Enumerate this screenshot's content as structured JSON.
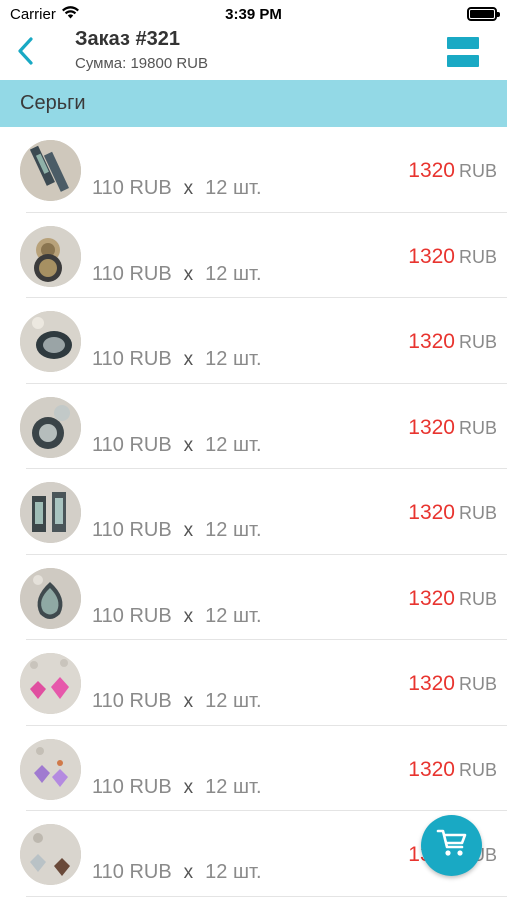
{
  "status_bar": {
    "carrier": "Carrier",
    "time": "3:39 PM",
    "wifi_icon": "wifi-icon",
    "battery_icon": "battery-icon"
  },
  "header": {
    "title": "Заказ #321",
    "sum": "Сумма: 19800 RUB",
    "back_icon": "chevron-left-icon",
    "menu_icon": "menu-icon",
    "accent_color": "#19a9c4"
  },
  "section": {
    "title": "Серьги",
    "color": "#93d9e6"
  },
  "items": [
    {
      "unit_price": "110 RUB",
      "times": "x",
      "qty": "12 шт.",
      "total_amount": "1320",
      "total_currency": "RUB"
    },
    {
      "unit_price": "110 RUB",
      "times": "x",
      "qty": "12 шт.",
      "total_amount": "1320",
      "total_currency": "RUB"
    },
    {
      "unit_price": "110 RUB",
      "times": "x",
      "qty": "12 шт.",
      "total_amount": "1320",
      "total_currency": "RUB"
    },
    {
      "unit_price": "110 RUB",
      "times": "x",
      "qty": "12 шт.",
      "total_amount": "1320",
      "total_currency": "RUB"
    },
    {
      "unit_price": "110 RUB",
      "times": "x",
      "qty": "12 шт.",
      "total_amount": "1320",
      "total_currency": "RUB"
    },
    {
      "unit_price": "110 RUB",
      "times": "x",
      "qty": "12 шт.",
      "total_amount": "1320",
      "total_currency": "RUB"
    },
    {
      "unit_price": "110 RUB",
      "times": "x",
      "qty": "12 шт.",
      "total_amount": "1320",
      "total_currency": "RUB"
    },
    {
      "unit_price": "110 RUB",
      "times": "x",
      "qty": "12 шт.",
      "total_amount": "1320",
      "total_currency": "RUB"
    },
    {
      "unit_price": "110 RUB",
      "times": "x",
      "qty": "12 шт.",
      "total_amount": "1320",
      "total_currency": "RUB"
    }
  ],
  "fab": {
    "icon": "cart-icon",
    "color": "#19a9c4"
  },
  "colors": {
    "total_amount": "#e8342f",
    "muted_text": "#8a8a8a"
  }
}
